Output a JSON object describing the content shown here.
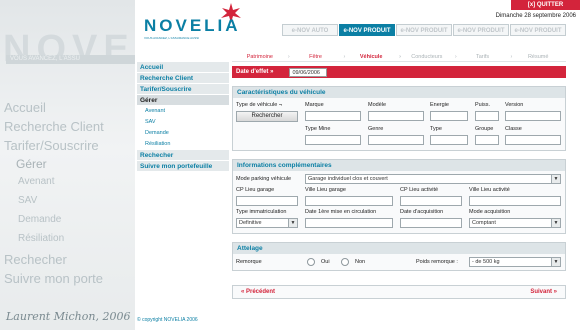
{
  "background": {
    "logo": "NOVE",
    "tagline": "VOUS AVANCEZ, L'ASSU",
    "menu": [
      "Accueil",
      "Recherche Client",
      "Tarifer/Souscrire",
      "Gérer",
      "Avenant",
      "SAV",
      "Demande",
      "Résiliation",
      "Rechecher",
      "Suivre mon porte"
    ],
    "signature": "Laurent Michon, 2006"
  },
  "header": {
    "logo": "NOVELIA",
    "tagline": "VOUS AVANCEZ, L'ASSURANCE AUSSI",
    "quit": "[x]  QUITTER",
    "date": "Dimanche 28 septembre 2006",
    "tabs": [
      "e-NOV AUTO",
      "e-NOV PRODUIT",
      "e-NOV PRODUIT",
      "e-NOV PRODUIT",
      "e-NOV PRODUIT"
    ]
  },
  "sidebar": {
    "items": [
      "Accueil",
      "Recherche Client",
      "Tarifer/Souscrire",
      "Gérer"
    ],
    "subitems": [
      "Avenant",
      "SAV",
      "Demande",
      "Résiliation"
    ],
    "items2": [
      "Rechecher",
      "Suivre mon portefeuille"
    ],
    "copyright": "© copyright NOVELIA 2006"
  },
  "steps": [
    "Patrimoine",
    "Fêtre",
    "Véhicule",
    "Conducteurs",
    "Tarifs",
    "Résumé"
  ],
  "form": {
    "date_effet_label": "Date d'effet »",
    "date_effet_value": "09/06/2006",
    "vehicle": {
      "title": "Caractéristiques du véhicule",
      "type_label": "Type de véhicule ¬",
      "search_button": "Rechercher",
      "labels_row1": [
        "Marque",
        "Modèle",
        "Energie",
        "Puiss.",
        "Version"
      ],
      "labels_row2": [
        "Type Mine",
        "Genre",
        "Type",
        "Groupe",
        "Classe"
      ]
    },
    "info": {
      "title": "Informations complémentaires",
      "parking_label": "Mode parking véhicule",
      "parking_value": "Garage individuel clos et couvert",
      "labels_row1": [
        "CP Lieu garage",
        "Ville Lieu garage",
        "CP Lieu activité",
        "Ville Lieu activité"
      ],
      "labels_row2": [
        "Type immatriculation",
        "Date 1ère mise en circulation",
        "Date d'acquisition",
        "Mode acquisition"
      ],
      "immat_value": "Definitive",
      "acquisition_value": "Comptant"
    },
    "attelage": {
      "title": "Attelage",
      "remorque_label": "Remorque",
      "oui": "Oui",
      "non": "Non",
      "poids_label": "Poids remorque :",
      "poids_value": "- de 500 kg"
    },
    "nav": {
      "prev": "« Précédent",
      "next": "Suivant »"
    }
  }
}
